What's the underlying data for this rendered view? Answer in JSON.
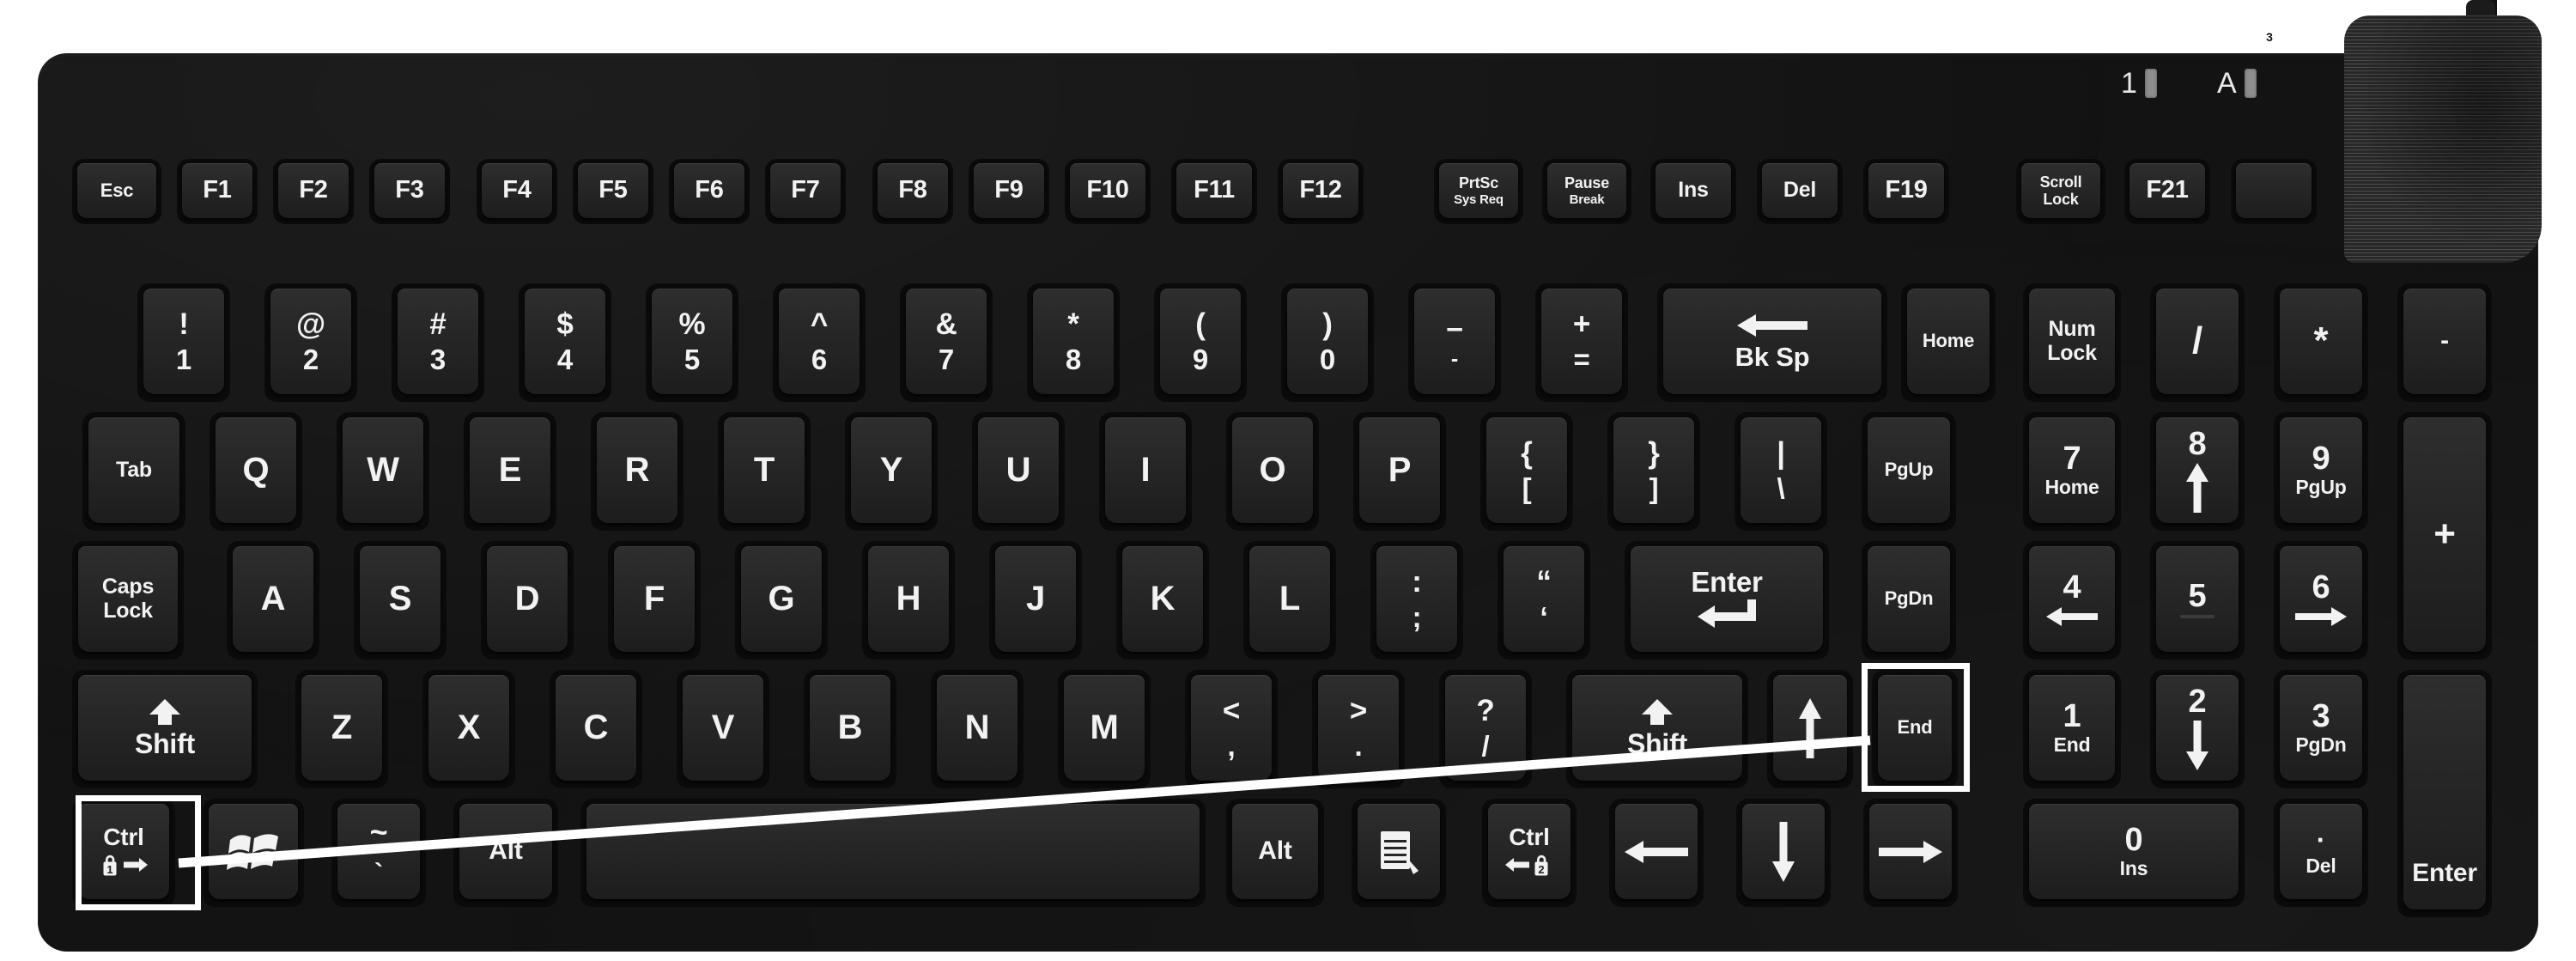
{
  "device": {
    "type": "usb-silicone-membrane-keyboard",
    "body_color": "#131313",
    "key_color": "#262626",
    "legend_color": "#f2f2f2",
    "highlight_color": "#ffffff"
  },
  "indicators": {
    "items": [
      {
        "label": "1",
        "name": "num-lock-led",
        "lit": false
      },
      {
        "label": "A",
        "name": "caps-lock-led",
        "lit": false
      }
    ],
    "lock_badge": {
      "label": "3",
      "name": "scroll-lock-badge-icon"
    }
  },
  "annotation": {
    "highlight_from": "Ctrl",
    "highlight_to": "End",
    "line_color": "#ffffff"
  },
  "rows": {
    "function_row": [
      {
        "label": "Esc",
        "cls": "word-sm"
      },
      {
        "label": "F1",
        "cls": "fn"
      },
      {
        "label": "F2",
        "cls": "fn"
      },
      {
        "label": "F3",
        "cls": "fn"
      },
      {
        "label": "F4",
        "cls": "fn"
      },
      {
        "label": "F5",
        "cls": "fn"
      },
      {
        "label": "F6",
        "cls": "fn"
      },
      {
        "label": "F7",
        "cls": "fn"
      },
      {
        "label": "F8",
        "cls": "fn"
      },
      {
        "label": "F9",
        "cls": "fn"
      },
      {
        "label": "F10",
        "cls": "fn"
      },
      {
        "label": "F11",
        "cls": "fn"
      },
      {
        "label": "F12",
        "cls": "fn"
      },
      {
        "label": "PrtSc",
        "sub": "Sys Req",
        "cls": "word-xs"
      },
      {
        "label": "Pause",
        "sub": "Break",
        "cls": "word-xs"
      },
      {
        "label": "Ins",
        "cls": "word"
      },
      {
        "label": "Del",
        "cls": "word"
      },
      {
        "label": "F19",
        "cls": "fn"
      },
      {
        "label": "Scroll",
        "sub": "Lock",
        "cls": "word-xs"
      },
      {
        "label": "F21",
        "cls": "fn"
      },
      {
        "label": "",
        "cls": "word"
      }
    ],
    "number_row": [
      {
        "top": "!",
        "bottom": "1"
      },
      {
        "top": "@",
        "bottom": "2"
      },
      {
        "top": "#",
        "bottom": "3"
      },
      {
        "top": "$",
        "bottom": "4"
      },
      {
        "top": "%",
        "bottom": "5"
      },
      {
        "top": "^",
        "bottom": "6"
      },
      {
        "top": "&",
        "bottom": "7"
      },
      {
        "top": "*",
        "bottom": "8"
      },
      {
        "top": "(",
        "bottom": "9"
      },
      {
        "top": ")",
        "bottom": "0"
      },
      {
        "top": "–",
        "bottom": "-"
      },
      {
        "top": "+",
        "bottom": "="
      }
    ],
    "number_row_extra": [
      {
        "label": "Bk Sp",
        "icon": "arrow-left-long-icon"
      },
      {
        "label": "Home"
      }
    ],
    "qwerty_row": [
      "Q",
      "W",
      "E",
      "R",
      "T",
      "Y",
      "U",
      "I",
      "O",
      "P"
    ],
    "qwerty_row_symbols": [
      {
        "top": "{",
        "bottom": "["
      },
      {
        "top": "}",
        "bottom": "]"
      },
      {
        "top": "|",
        "bottom": "\\"
      }
    ],
    "qwerty_left": "Tab",
    "qwerty_right": "PgUp",
    "home_row": [
      "A",
      "S",
      "D",
      "F",
      "G",
      "H",
      "J",
      "K",
      "L"
    ],
    "home_row_symbols": [
      {
        "top": ":",
        "bottom": ";"
      },
      {
        "top": "“",
        "bottom": "‘"
      }
    ],
    "home_left_top": "Caps",
    "home_left_bottom": "Lock",
    "home_enter": "Enter",
    "home_right": "PgDn",
    "shift_row": [
      "Z",
      "X",
      "C",
      "V",
      "B",
      "N",
      "M"
    ],
    "shift_row_symbols": [
      {
        "top": "<",
        "bottom": ","
      },
      {
        "top": ">",
        "bottom": "."
      },
      {
        "top": "?",
        "bottom": "/"
      }
    ],
    "shift_left": "Shift",
    "shift_right": "Shift",
    "shift_row_arrow": "arrow-up-icon",
    "shift_row_end": "End",
    "bottom_row": {
      "ctrl_left": "Ctrl",
      "ctrl_left_badge": "1",
      "win": "windows-logo-icon",
      "tilde_top": "~",
      "tilde_bottom": "`",
      "alt_left": "Alt",
      "space": "",
      "alt_right": "Alt",
      "menu": "context-menu-icon",
      "ctrl_right": "Ctrl",
      "ctrl_right_badge": "2",
      "arrow_left": "arrow-left-icon",
      "arrow_down": "arrow-down-icon",
      "arrow_right": "arrow-right-icon"
    }
  },
  "numpad": {
    "row1": [
      {
        "top": "Num",
        "bottom": "Lock"
      },
      {
        "label": "/"
      },
      {
        "label": "*"
      },
      {
        "label": "-"
      }
    ],
    "row2": [
      {
        "num": "7",
        "sub": "Home"
      },
      {
        "num": "8",
        "icon": "arrow-up-icon"
      },
      {
        "num": "9",
        "sub": "PgUp"
      },
      {
        "label": "+"
      }
    ],
    "row3": [
      {
        "num": "4",
        "icon": "arrow-left-icon"
      },
      {
        "num": "5",
        "sub": ""
      },
      {
        "num": "6",
        "icon": "arrow-right-icon"
      }
    ],
    "row4": [
      {
        "num": "1",
        "sub": "End"
      },
      {
        "num": "2",
        "icon": "arrow-down-icon"
      },
      {
        "num": "3",
        "sub": "PgDn"
      },
      {
        "label": "Enter"
      }
    ],
    "row5": [
      {
        "num": "0",
        "sub": "Ins"
      },
      {
        "num": "·",
        "sub": "Del"
      }
    ]
  }
}
